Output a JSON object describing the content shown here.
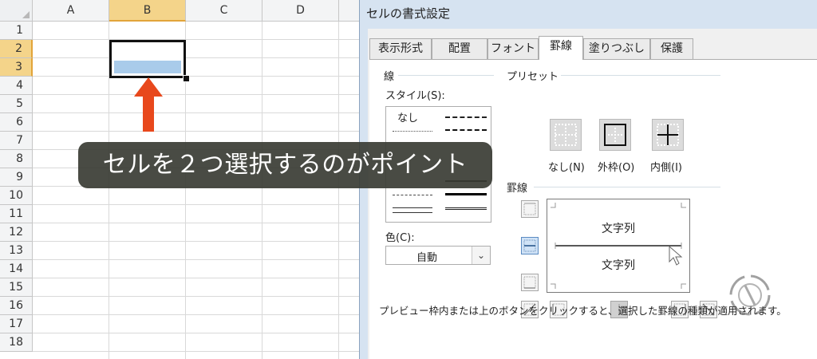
{
  "spreadsheet": {
    "columns": [
      "A",
      "B",
      "C",
      "D"
    ],
    "selected_column": "B",
    "rows": [
      "1",
      "2",
      "3",
      "4",
      "5",
      "6",
      "7",
      "8",
      "9",
      "10",
      "11",
      "12",
      "13",
      "14",
      "15",
      "16",
      "17",
      "18"
    ],
    "selected_rows": [
      "2",
      "3"
    ]
  },
  "caption": "セルを２つ選択するのがポイント",
  "dialog": {
    "title": "セルの書式設定",
    "tabs": [
      "表示形式",
      "配置",
      "フォント",
      "罫線",
      "塗りつぶし",
      "保護"
    ],
    "active_tab": "罫線",
    "line_group": "線",
    "style_label": "スタイル(S):",
    "style_none": "なし",
    "color_label": "色(C):",
    "color_value": "自動",
    "preset_group": "プリセット",
    "presets": [
      "なし(N)",
      "外枠(O)",
      "内側(I)"
    ],
    "border_group": "罫線",
    "preview_text_top": "文字列",
    "preview_text_bottom": "文字列",
    "hint": "プレビュー枠内または上のボタンをクリックすると、選択した罫線の種類が適用されます。"
  },
  "colors": {
    "selection_fill": "#a9cbea",
    "header_highlight": "#f4d48a",
    "arrow": "#e8481c",
    "caption_bg": "#3a3c34"
  }
}
